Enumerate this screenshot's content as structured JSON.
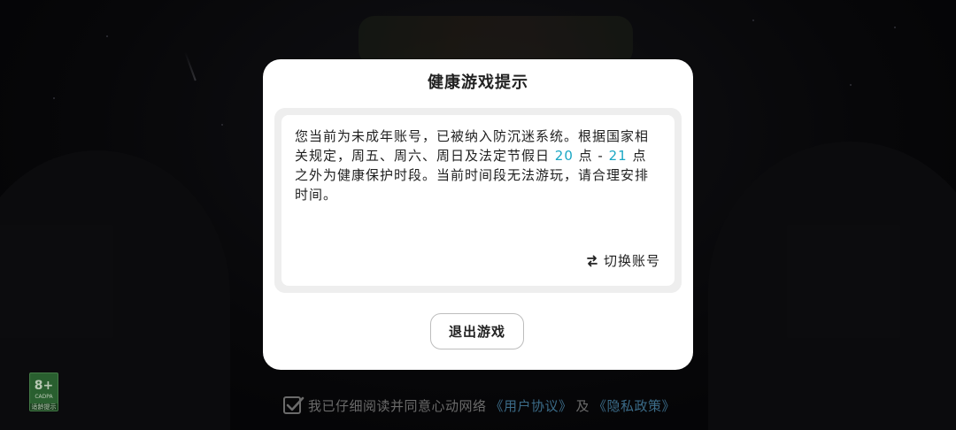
{
  "dialog": {
    "title": "健康游戏提示",
    "message_part1": "您当前为未成年账号，已被纳入防沉迷系统。根据国家相关规定，周五、周六、周日及法定节假日 ",
    "highlight_start": "20",
    "message_part2": " 点 - ",
    "highlight_end": "21",
    "message_part3": " 点之外为健康保护时段。当前时间段无法游玩，请合理安排时间。",
    "highlight_color": "#1aa7c4",
    "switch_account_label": "切换账号",
    "exit_button_label": "退出游戏"
  },
  "age_rating": {
    "age": "8+",
    "sub_text": "CADPA",
    "caption": "适龄提示"
  },
  "agreement": {
    "text": "我已仔细阅读并同意心动网络",
    "user_agreement_link": "《用户协议》",
    "and_text": "及",
    "privacy_policy_link": "《隐私政策》",
    "checked": true
  },
  "icons": {
    "switch": "swap-arrows-icon",
    "check": "checkmark-icon"
  }
}
